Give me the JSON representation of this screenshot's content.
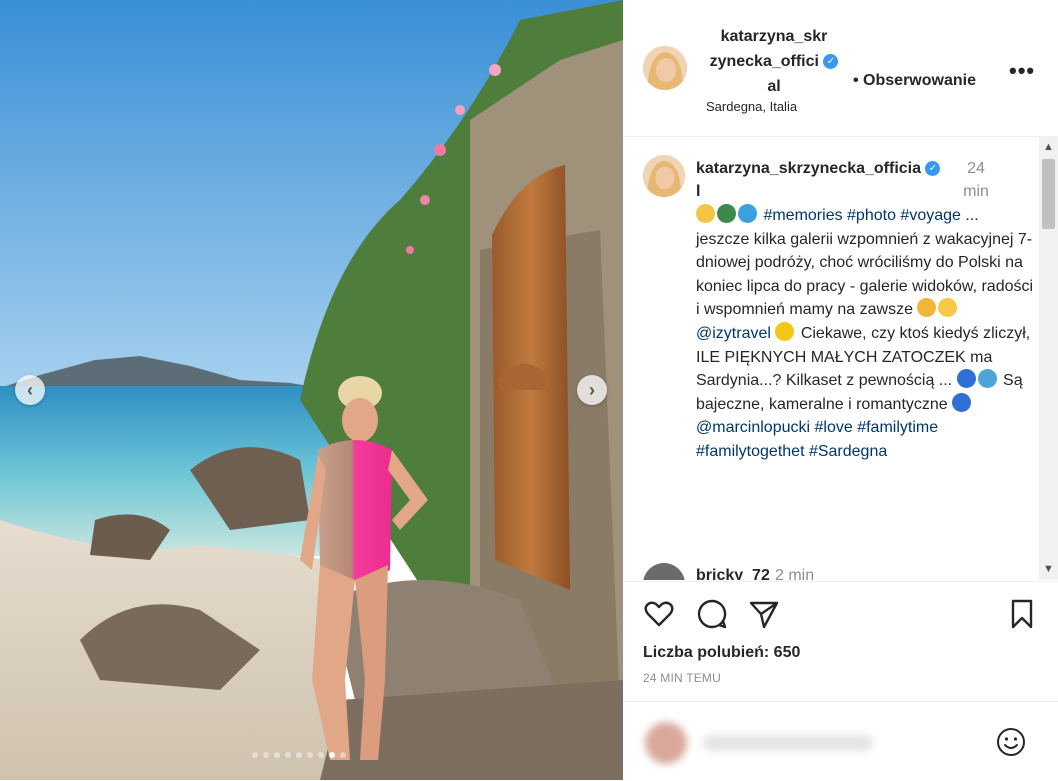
{
  "post": {
    "username_line1": "katarzyna_skr",
    "username_line2": "zynecka_offici",
    "username_line3": "al",
    "follow_label": "• Obserwowanie",
    "location": "Sardegna, Italia",
    "more_label": "•••"
  },
  "caption": {
    "username_line1": "katarzyna_skrzynecka_officia",
    "username_line2": "l",
    "time_line1": "24",
    "time_line2": "min",
    "tags1": "#memories #photo #voyage",
    "text1": " ... jeszcze kilka galerii wzpomnień z wakacyjnej 7-dniowej podróży, choć wróciliśmy do Polski na koniec lipca do pracy - galerie widoków, radości i wspomnień mamy na zawsze ",
    "mention1": "@izytravel",
    "text2": " Ciekawe, czy ktoś kiedyś zliczył, ILE PIĘKNYCH MAŁYCH ZATOCZEK ma Sardynia...? Kilkaset z pewnością ... ",
    "text3": " Są bajeczne, kameralne i romantyczne ",
    "tags2": "@marcinlopucki #love #familytime #familytogethet #Sardegna"
  },
  "comment": {
    "username": "bricky_72",
    "time": "2 min"
  },
  "actions": {
    "likes": "Liczba polubień: 650",
    "time_ago": "24 MIN TEMU"
  },
  "carousel": {
    "prev_label": "‹",
    "next_label": "›",
    "dot_count": 9,
    "active_dot": 7
  },
  "colors": {
    "link": "#00376b",
    "verified": "#3897f0",
    "muted": "#8e8e8e"
  },
  "icons": [
    "heart-icon",
    "comment-icon",
    "share-icon",
    "bookmark-icon",
    "more-icon",
    "verified-icon",
    "smile-icon"
  ]
}
